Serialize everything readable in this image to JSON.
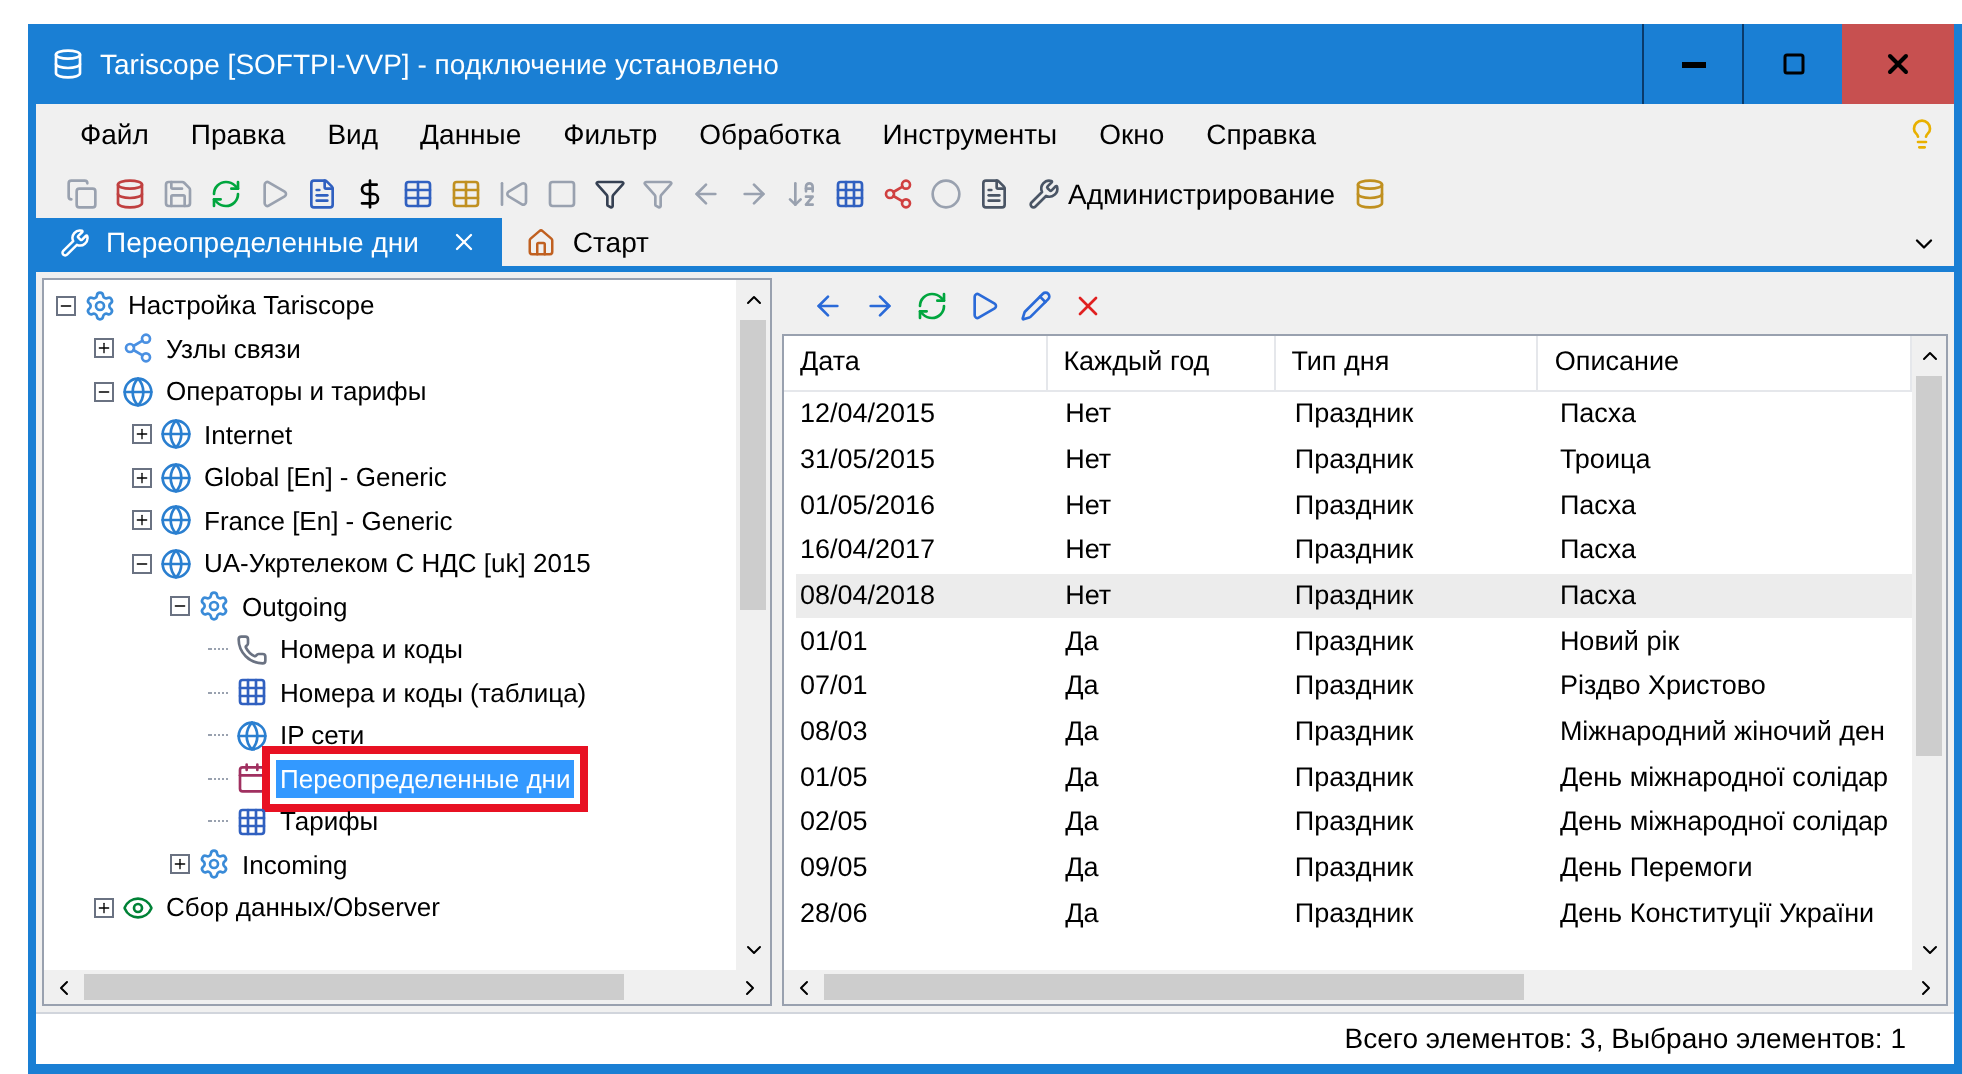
{
  "window": {
    "title": "Tariscope [SOFTPI-VVP] - подключение установлено"
  },
  "menu": [
    "Файл",
    "Правка",
    "Вид",
    "Данные",
    "Фильтр",
    "Обработка",
    "Инструменты",
    "Окно",
    "Справка"
  ],
  "toolbar": {
    "admin_label": "Администрирование"
  },
  "tabs": [
    {
      "label": "Переопределенные дни",
      "selected": true,
      "closable": true
    },
    {
      "label": "Старт",
      "selected": false,
      "closable": false
    }
  ],
  "tree": [
    {
      "label": "Настройка Tariscope",
      "kind": "gear",
      "expanded": true,
      "selected": false,
      "children": [
        {
          "label": "Узлы связи",
          "kind": "nodes",
          "expanded": false,
          "selected": false
        },
        {
          "label": "Операторы и тарифы",
          "kind": "globe",
          "expanded": true,
          "selected": false,
          "children": [
            {
              "label": "Internet",
              "kind": "globe",
              "expanded": false,
              "selected": false
            },
            {
              "label": "Global [En] - Generic",
              "kind": "globe",
              "expanded": false,
              "selected": false
            },
            {
              "label": "France [En] - Generic",
              "kind": "globe",
              "expanded": false,
              "selected": false
            },
            {
              "label": "UA-Укртелеком С НДС [uk] 2015",
              "kind": "globe",
              "expanded": true,
              "selected": false,
              "children": [
                {
                  "label": "Outgoing",
                  "kind": "gear",
                  "expanded": true,
                  "selected": false,
                  "children": [
                    {
                      "label": "Номера и коды",
                      "kind": "phone",
                      "selected": false
                    },
                    {
                      "label": "Номера и коды (таблица)",
                      "kind": "table",
                      "selected": false
                    },
                    {
                      "label": "IP сети",
                      "kind": "globe",
                      "selected": false
                    },
                    {
                      "label": "Переопределенные дни",
                      "kind": "calendar",
                      "selected": true
                    },
                    {
                      "label": "Тарифы",
                      "kind": "table",
                      "selected": false
                    }
                  ]
                },
                {
                  "label": "Incoming",
                  "kind": "gear",
                  "expanded": false,
                  "selected": false
                }
              ]
            }
          ]
        },
        {
          "label": "Сбор данных/Observer",
          "kind": "observer",
          "expanded": false,
          "selected": false
        }
      ]
    }
  ],
  "table": {
    "columns": [
      "Дата",
      "Каждый год",
      "Тип дня",
      "Описание"
    ],
    "rows": [
      {
        "cells": [
          "12/04/2015",
          "Нет",
          "Праздник",
          "Пасха"
        ],
        "selected": false
      },
      {
        "cells": [
          "31/05/2015",
          "Нет",
          "Праздник",
          "Троица"
        ],
        "selected": false
      },
      {
        "cells": [
          "01/05/2016",
          "Нет",
          "Праздник",
          "Пасха"
        ],
        "selected": false
      },
      {
        "cells": [
          "16/04/2017",
          "Нет",
          "Праздник",
          "Пасха"
        ],
        "selected": false
      },
      {
        "cells": [
          "08/04/2018",
          "Нет",
          "Праздник",
          "Пасха"
        ],
        "selected": true
      },
      {
        "cells": [
          "01/01",
          "Да",
          "Праздник",
          "Новий рік"
        ],
        "selected": false
      },
      {
        "cells": [
          "07/01",
          "Да",
          "Праздник",
          "Різдво Христово"
        ],
        "selected": false
      },
      {
        "cells": [
          "08/03",
          "Да",
          "Праздник",
          "Міжнародний жіночий ден"
        ],
        "selected": false
      },
      {
        "cells": [
          "01/05",
          "Да",
          "Праздник",
          "День міжнародної солідар"
        ],
        "selected": false
      },
      {
        "cells": [
          "02/05",
          "Да",
          "Праздник",
          "День міжнародної солідар"
        ],
        "selected": false
      },
      {
        "cells": [
          "09/05",
          "Да",
          "Праздник",
          "День Перемоги"
        ],
        "selected": false
      },
      {
        "cells": [
          "28/06",
          "Да",
          "Праздник",
          "День Конституції України"
        ],
        "selected": false
      }
    ]
  },
  "status_bar": "Всего элементов: 3, Выбрано элементов: 1"
}
